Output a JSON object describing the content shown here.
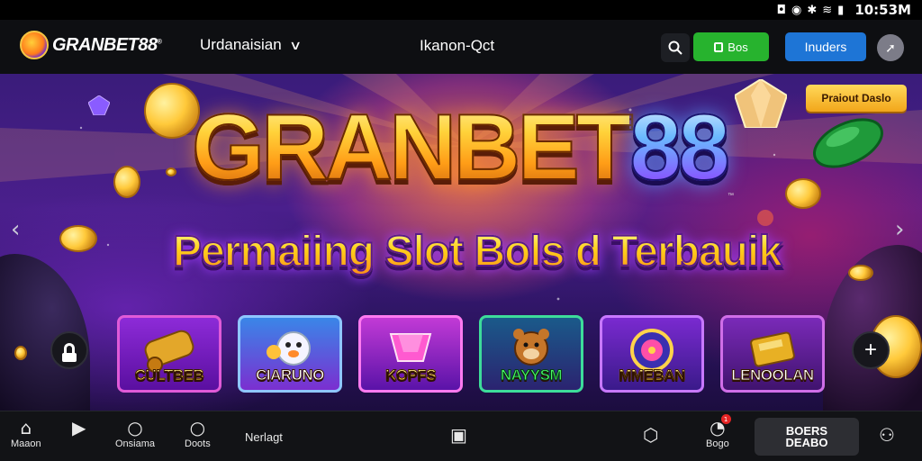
{
  "status_bar": {
    "time": "10:53M"
  },
  "header": {
    "logo_text": "GRANBET88",
    "logo_mark": "®",
    "nav_dropdown_label": "Urdanaisian",
    "nav_link_label": "Ikanon-Qct",
    "green_button_label": "Bos",
    "blue_button_label": "Inuders",
    "icons": [
      "search-icon",
      "wallet-icon",
      "user-icon",
      "chevron-down-icon"
    ]
  },
  "hero": {
    "title_part1": "GRANBET",
    "title_part2": "88",
    "trademark": "™",
    "subtitle": "Permaiing Slot Bols d Terbauik",
    "promo_badge": "Praiout Daslo",
    "games": [
      {
        "label": "CULTBEB"
      },
      {
        "label": "CIARUNO"
      },
      {
        "label": "KOPFS"
      },
      {
        "label": "NAYYSM"
      },
      {
        "label": "MMEBAN"
      },
      {
        "label": "LENOOLAN"
      }
    ]
  },
  "bottom_bar": {
    "items": [
      {
        "label": "Maaon",
        "icon": "home-icon"
      },
      {
        "label": "",
        "icon": "play-icon"
      },
      {
        "label": "Onsiama",
        "icon": "circle-icon"
      },
      {
        "label": "Doots",
        "icon": "circle-icon"
      }
    ],
    "text_link": "Nerlagt",
    "bos_label": "Bogo",
    "notification_count": "1",
    "cta_line1": "BOERS",
    "cta_line2": "DEABO"
  },
  "colors": {
    "accent_green": "#27b32e",
    "accent_blue": "#1e75d6",
    "promo_gold": "#f2a61a",
    "hero_purple": "#4a1f8c"
  }
}
